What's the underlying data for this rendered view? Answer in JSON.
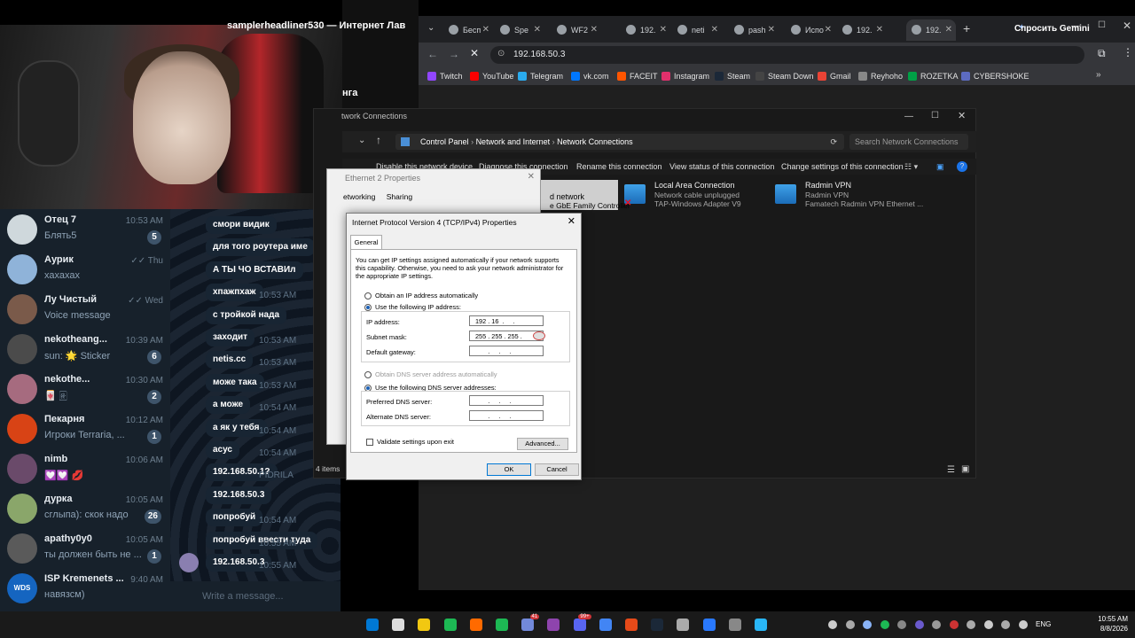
{
  "telegram": {
    "header_name": "samplerheadliner530 — Интернет Лав",
    "header_line2": "нга",
    "chats": [
      {
        "name": "Отец 7",
        "time": "10:53 AM",
        "preview": "Блять5",
        "badge": "5",
        "avatar_color": "#cfd8dc"
      },
      {
        "name": "Аурик",
        "time": "✓✓ Thu",
        "preview": "хахахах",
        "badge": "",
        "avatar_color": "#8fb3d9"
      },
      {
        "name": "Лу Чистый",
        "time": "✓✓ Wed",
        "preview": "Voice message",
        "badge": "",
        "avatar_color": "#7a5a4a"
      },
      {
        "name": "nekotheang...",
        "time": "10:39 AM",
        "preview": "sun: 🌟 Sticker",
        "badge": "6",
        "avatar_color": "#4b4b4b"
      },
      {
        "name": "nekothe...",
        "time": "10:30 AM",
        "preview": "🀄 🀅",
        "badge": "2",
        "avatar_color": "#a66b7f"
      },
      {
        "name": "Пекарня",
        "time": "10:12 AM",
        "preview": "Игроки Terraria, ...",
        "badge": "1",
        "avatar_color": "#d84315"
      },
      {
        "name": "nimb",
        "time": "10:06 AM",
        "preview": "💟💟 💋",
        "badge": "",
        "avatar_color": "#6a4a6a"
      },
      {
        "name": "дурка",
        "time": "10:05 AM",
        "preview": "сглыпа): скок надо",
        "badge": "26",
        "avatar_color": "#8aa66a"
      },
      {
        "name": "apathy0y0",
        "time": "10:05 AM",
        "preview": "ты должен быть не ...",
        "badge": "1",
        "avatar_color": "#5a5a5a"
      },
      {
        "name": "ISP Kremenets ...",
        "time": "9:40 AM",
        "preview": "навязсм)",
        "badge": "",
        "avatar_color": "#1565c0",
        "avatar_text": "WDS"
      }
    ],
    "messages": [
      {
        "text": "смори видик",
        "time": ""
      },
      {
        "text": "для того роутера име",
        "time": ""
      },
      {
        "text": "А ТЫ ЧО ВСТАВИл",
        "time": ""
      },
      {
        "text": "хпажпхаж",
        "time": "10:53 AM"
      },
      {
        "text": "с тройкой нада",
        "time": ""
      },
      {
        "text": "заходит",
        "time": "10:53 AM"
      },
      {
        "text": "netis.cc",
        "time": "10:53 AM"
      },
      {
        "text": "може така",
        "time": "10:53 AM"
      },
      {
        "text": "а може",
        "time": "10:54 AM"
      },
      {
        "text": "а як у тебя",
        "time": "10:54 AM"
      },
      {
        "text": "асус",
        "time": "10:54 AM"
      },
      {
        "text": "192.168.50.1?",
        "time": "PIDRILA"
      },
      {
        "text": "192.168.50.3",
        "time": ""
      },
      {
        "text": "попробуй",
        "time": "10:54 AM"
      },
      {
        "text": "попробуй ввести туда",
        "time": "10:55 AM"
      },
      {
        "text": "192.168.50.3",
        "time": "10:55 AM"
      }
    ],
    "input_placeholder": "Write a message..."
  },
  "chrome": {
    "tabs": [
      {
        "label": "Бесп"
      },
      {
        "label": "Spe"
      },
      {
        "label": "WF2"
      },
      {
        "label": "192."
      },
      {
        "label": "neti"
      },
      {
        "label": "pash"
      },
      {
        "label": "Испо"
      },
      {
        "label": "192."
      },
      {
        "label": "192."
      }
    ],
    "gemini_label": "Спросить Gemini",
    "url": "192.168.50.3",
    "bookmarks": [
      {
        "label": "Twitch",
        "color": "#9146ff"
      },
      {
        "label": "YouTube",
        "color": "#ff0000"
      },
      {
        "label": "Telegram",
        "color": "#2aabee"
      },
      {
        "label": "vk.com",
        "color": "#0077ff"
      },
      {
        "label": "FACEIT",
        "color": "#ff5500"
      },
      {
        "label": "Instagram",
        "color": "#e1306c"
      },
      {
        "label": "Steam",
        "color": "#1b2838"
      },
      {
        "label": "Steam Down",
        "color": "#444"
      },
      {
        "label": "Gmail",
        "color": "#ea4335"
      },
      {
        "label": "Reyhoho",
        "color": "#888"
      },
      {
        "label": "ROZETKA",
        "color": "#00a046"
      },
      {
        "label": "CYBERSHOKE",
        "color": "#5c6bc0"
      }
    ]
  },
  "explorer": {
    "title": "twork Connections",
    "breadcrumb": [
      "Control Panel",
      "Network and Internet",
      "Network Connections"
    ],
    "search_placeholder": "Search Network Connections",
    "commands": [
      "Disable this network device",
      "Diagnose this connection",
      "Rename this connection",
      "View status of this connection",
      "Change settings of this connection"
    ],
    "adapters": [
      {
        "name": "d network",
        "line2": "e GbE Family Controller",
        "line3": ""
      },
      {
        "name": "Local Area Connection",
        "line2": "Network cable unplugged",
        "line3": "TAP-Windows Adapter V9"
      },
      {
        "name": "Radmin VPN",
        "line2": "Radmin VPN",
        "line3": "Famatech Radmin VPN Ethernet ..."
      }
    ],
    "status": "4 items"
  },
  "eth_props": {
    "title": "Ethernet 2 Properties",
    "tabs": [
      "etworking",
      "Sharing"
    ]
  },
  "ipv4": {
    "title": "Internet Protocol Version 4 (TCP/IPv4) Properties",
    "tab": "General",
    "description": "You can get IP settings assigned automatically if your network supports this capability. Otherwise, you need to ask your network administrator for the appropriate IP settings.",
    "radio_auto_ip": "Obtain an IP address automatically",
    "radio_manual_ip": "Use the following IP address:",
    "ip_label": "IP address:",
    "ip_value": "192 . 16  .     .",
    "mask_label": "Subnet mask:",
    "mask_value": "255 . 255 . 255 .",
    "gw_label": "Default gateway:",
    "gw_value": "       .     .     .",
    "radio_auto_dns": "Obtain DNS server address automatically",
    "radio_manual_dns": "Use the following DNS server addresses:",
    "pdns_label": "Preferred DNS server:",
    "pdns_value": "       .     .     .",
    "adns_label": "Alternate DNS server:",
    "adns_value": "       .     .     .",
    "validate_label": "Validate settings upon exit",
    "advanced_label": "Advanced...",
    "ok_label": "OK",
    "cancel_label": "Cancel"
  },
  "taskbar": {
    "lang": "ENG",
    "time": "10:55 AM",
    "date": "8/8/2026",
    "badges": [
      "41",
      "99+"
    ]
  }
}
